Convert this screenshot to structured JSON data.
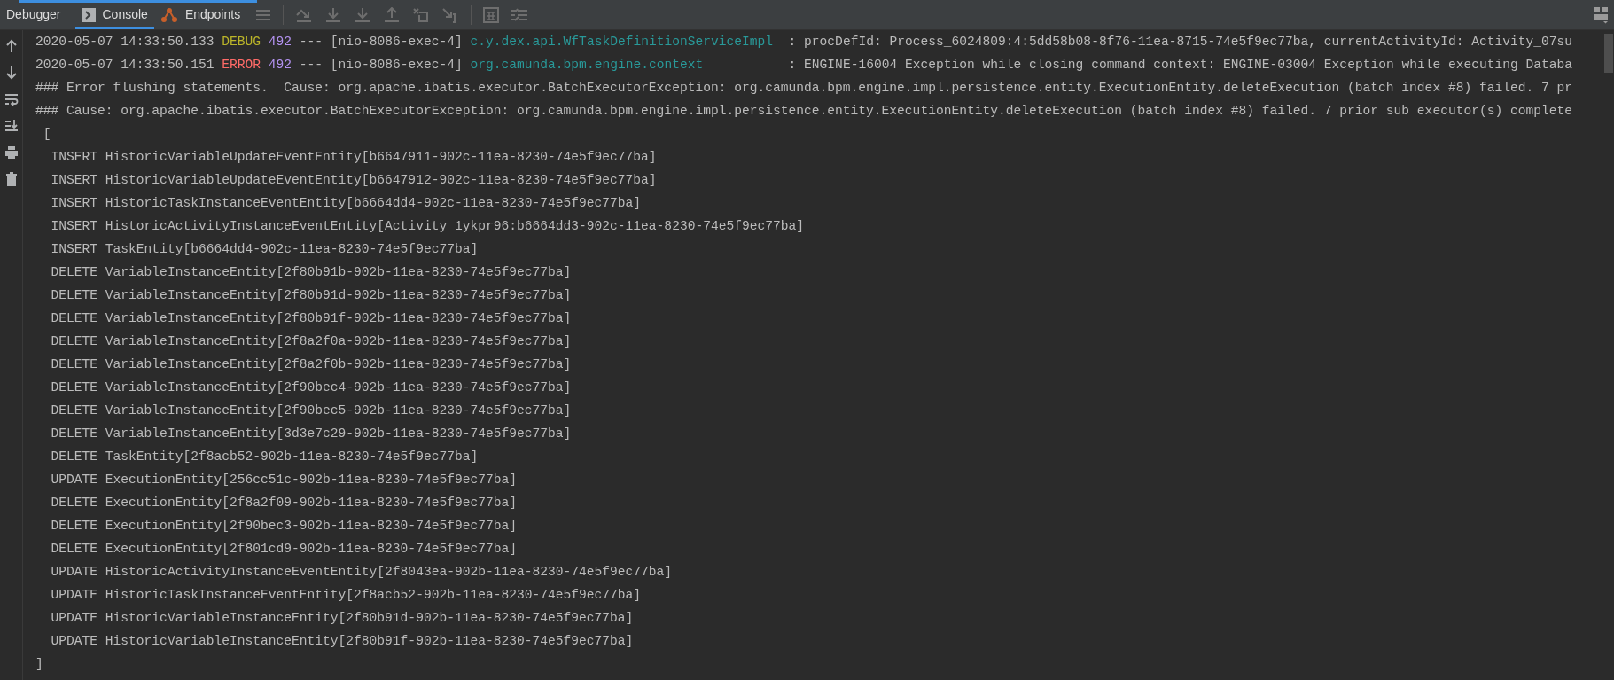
{
  "tabs": [
    {
      "label": "Debugger",
      "selected": false,
      "kind": "plain"
    },
    {
      "label": "Console",
      "selected": true,
      "kind": "console"
    },
    {
      "label": "Endpoints",
      "selected": false,
      "kind": "endpoints"
    }
  ],
  "log": [
    {
      "kind": "log",
      "timestamp": "2020-05-07 14:33:50.133",
      "level": "DEBUG",
      "color": "#bbb529",
      "pid": "492",
      "separator": "---",
      "thread": "[nio-8086-exec-4]",
      "logger": "c.y.dex.api.WfTaskDefinitionServiceImpl",
      "message": ": procDefId: Process_6024809:4:5dd58b08-8f76-11ea-8715-74e5f9ec77ba, currentActivityId: Activity_07su"
    },
    {
      "kind": "log",
      "timestamp": "2020-05-07 14:33:50.151",
      "level": "ERROR",
      "color": "#ff6b68",
      "pid": "492",
      "separator": "---",
      "thread": "[nio-8086-exec-4]",
      "logger": "org.camunda.bpm.engine.context",
      "message": ": ENGINE-16004 Exception while closing command context: ENGINE-03004 Exception while executing Databa"
    },
    {
      "kind": "text",
      "text": "### Error flushing statements.  Cause: org.apache.ibatis.executor.BatchExecutorException: org.camunda.bpm.engine.impl.persistence.entity.ExecutionEntity.deleteExecution (batch index #8) failed. 7 pr"
    },
    {
      "kind": "text",
      "text": "### Cause: org.apache.ibatis.executor.BatchExecutorException: org.camunda.bpm.engine.impl.persistence.entity.ExecutionEntity.deleteExecution (batch index #8) failed. 7 prior sub executor(s) complete"
    },
    {
      "kind": "text",
      "text": " ["
    },
    {
      "kind": "text",
      "text": "  INSERT HistoricVariableUpdateEventEntity[b6647911-902c-11ea-8230-74e5f9ec77ba]"
    },
    {
      "kind": "text",
      "text": "  INSERT HistoricVariableUpdateEventEntity[b6647912-902c-11ea-8230-74e5f9ec77ba]"
    },
    {
      "kind": "text",
      "text": "  INSERT HistoricTaskInstanceEventEntity[b6664dd4-902c-11ea-8230-74e5f9ec77ba]"
    },
    {
      "kind": "text",
      "text": "  INSERT HistoricActivityInstanceEventEntity[Activity_1ykpr96:b6664dd3-902c-11ea-8230-74e5f9ec77ba]"
    },
    {
      "kind": "text",
      "text": "  INSERT TaskEntity[b6664dd4-902c-11ea-8230-74e5f9ec77ba]"
    },
    {
      "kind": "text",
      "text": "  DELETE VariableInstanceEntity[2f80b91b-902b-11ea-8230-74e5f9ec77ba]"
    },
    {
      "kind": "text",
      "text": "  DELETE VariableInstanceEntity[2f80b91d-902b-11ea-8230-74e5f9ec77ba]"
    },
    {
      "kind": "text",
      "text": "  DELETE VariableInstanceEntity[2f80b91f-902b-11ea-8230-74e5f9ec77ba]"
    },
    {
      "kind": "text",
      "text": "  DELETE VariableInstanceEntity[2f8a2f0a-902b-11ea-8230-74e5f9ec77ba]"
    },
    {
      "kind": "text",
      "text": "  DELETE VariableInstanceEntity[2f8a2f0b-902b-11ea-8230-74e5f9ec77ba]"
    },
    {
      "kind": "text",
      "text": "  DELETE VariableInstanceEntity[2f90bec4-902b-11ea-8230-74e5f9ec77ba]"
    },
    {
      "kind": "text",
      "text": "  DELETE VariableInstanceEntity[2f90bec5-902b-11ea-8230-74e5f9ec77ba]"
    },
    {
      "kind": "text",
      "text": "  DELETE VariableInstanceEntity[3d3e7c29-902b-11ea-8230-74e5f9ec77ba]"
    },
    {
      "kind": "text",
      "text": "  DELETE TaskEntity[2f8acb52-902b-11ea-8230-74e5f9ec77ba]"
    },
    {
      "kind": "text",
      "text": "  UPDATE ExecutionEntity[256cc51c-902b-11ea-8230-74e5f9ec77ba]"
    },
    {
      "kind": "text",
      "text": "  DELETE ExecutionEntity[2f8a2f09-902b-11ea-8230-74e5f9ec77ba]"
    },
    {
      "kind": "text",
      "text": "  DELETE ExecutionEntity[2f90bec3-902b-11ea-8230-74e5f9ec77ba]"
    },
    {
      "kind": "text",
      "text": "  DELETE ExecutionEntity[2f801cd9-902b-11ea-8230-74e5f9ec77ba]"
    },
    {
      "kind": "text",
      "text": "  UPDATE HistoricActivityInstanceEventEntity[2f8043ea-902b-11ea-8230-74e5f9ec77ba]"
    },
    {
      "kind": "text",
      "text": "  UPDATE HistoricTaskInstanceEventEntity[2f8acb52-902b-11ea-8230-74e5f9ec77ba]"
    },
    {
      "kind": "text",
      "text": "  UPDATE HistoricVariableInstanceEntity[2f80b91d-902b-11ea-8230-74e5f9ec77ba]"
    },
    {
      "kind": "text",
      "text": "  UPDATE HistoricVariableInstanceEntity[2f80b91f-902b-11ea-8230-74e5f9ec77ba]"
    },
    {
      "kind": "text",
      "text": "]"
    }
  ]
}
